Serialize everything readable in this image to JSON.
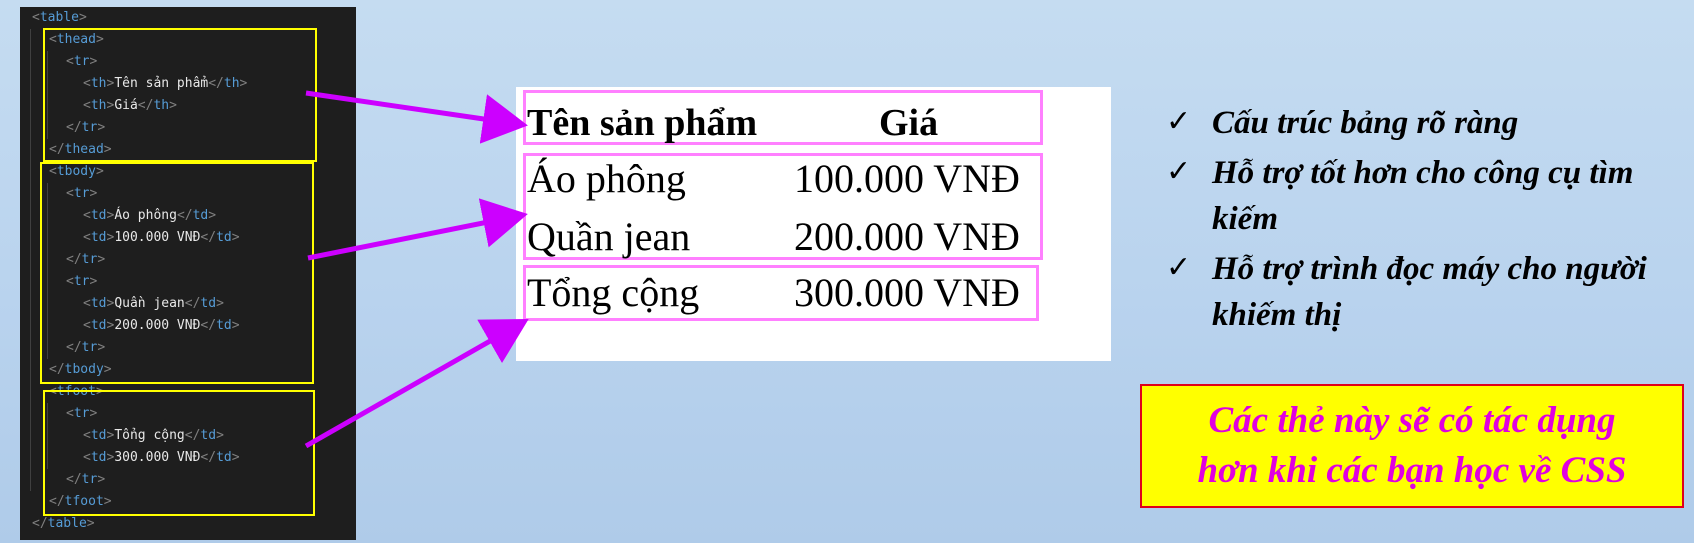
{
  "code": {
    "lines": [
      {
        "indent": 0,
        "open": "<",
        "tag": "table",
        "text": "",
        "close_tag": "",
        "end": ">"
      },
      {
        "indent": 1,
        "open": "<",
        "tag": "thead",
        "text": "",
        "close_tag": "",
        "end": ">"
      },
      {
        "indent": 2,
        "open": "<",
        "tag": "tr",
        "text": "",
        "close_tag": "",
        "end": ">"
      },
      {
        "indent": 3,
        "open": "<",
        "tag": "th",
        "text": "Tên sản phẩm",
        "close_tag": "th",
        "end": ">"
      },
      {
        "indent": 3,
        "open": "<",
        "tag": "th",
        "text": "Giá",
        "close_tag": "th",
        "end": ">"
      },
      {
        "indent": 2,
        "open": "</",
        "tag": "tr",
        "text": "",
        "close_tag": "",
        "end": ">"
      },
      {
        "indent": 1,
        "open": "</",
        "tag": "thead",
        "text": "",
        "close_tag": "",
        "end": ">"
      },
      {
        "indent": 1,
        "open": "<",
        "tag": "tbody",
        "text": "",
        "close_tag": "",
        "end": ">"
      },
      {
        "indent": 2,
        "open": "<",
        "tag": "tr",
        "text": "",
        "close_tag": "",
        "end": ">"
      },
      {
        "indent": 3,
        "open": "<",
        "tag": "td",
        "text": "Áo phông",
        "close_tag": "td",
        "end": ">"
      },
      {
        "indent": 3,
        "open": "<",
        "tag": "td",
        "text": "100.000 VNĐ",
        "close_tag": "td",
        "end": ">"
      },
      {
        "indent": 2,
        "open": "</",
        "tag": "tr",
        "text": "",
        "close_tag": "",
        "end": ">"
      },
      {
        "indent": 2,
        "open": "<",
        "tag": "tr",
        "text": "",
        "close_tag": "",
        "end": ">"
      },
      {
        "indent": 3,
        "open": "<",
        "tag": "td",
        "text": "Quần jean",
        "close_tag": "td",
        "end": ">"
      },
      {
        "indent": 3,
        "open": "<",
        "tag": "td",
        "text": "200.000 VNĐ",
        "close_tag": "td",
        "end": ">"
      },
      {
        "indent": 2,
        "open": "</",
        "tag": "tr",
        "text": "",
        "close_tag": "",
        "end": ">"
      },
      {
        "indent": 1,
        "open": "</",
        "tag": "tbody",
        "text": "",
        "close_tag": "",
        "end": ">"
      },
      {
        "indent": 1,
        "open": "<",
        "tag": "tfoot",
        "text": "",
        "close_tag": "",
        "end": ">"
      },
      {
        "indent": 2,
        "open": "<",
        "tag": "tr",
        "text": "",
        "close_tag": "",
        "end": ">"
      },
      {
        "indent": 3,
        "open": "<",
        "tag": "td",
        "text": "Tổng cộng",
        "close_tag": "td",
        "end": ">"
      },
      {
        "indent": 3,
        "open": "<",
        "tag": "td",
        "text": "300.000 VNĐ",
        "close_tag": "td",
        "end": ">"
      },
      {
        "indent": 2,
        "open": "</",
        "tag": "tr",
        "text": "",
        "close_tag": "",
        "end": ">"
      },
      {
        "indent": 1,
        "open": "</",
        "tag": "tfoot",
        "text": "",
        "close_tag": "",
        "end": ">"
      },
      {
        "indent": 0,
        "open": "</",
        "tag": "table",
        "text": "",
        "close_tag": "",
        "end": ">"
      }
    ]
  },
  "preview": {
    "header": [
      "Tên sản phẩm",
      "Giá"
    ],
    "rows": [
      [
        "Áo phông",
        "100.000 VNĐ"
      ],
      [
        "Quần jean",
        "200.000 VNĐ"
      ]
    ],
    "footer": [
      "Tổng cộng",
      "300.000 VNĐ"
    ]
  },
  "bullets": {
    "mark": "✓",
    "items": [
      "Cấu trúc bảng rõ ràng",
      "Hỗ trợ tốt hơn cho công cụ tìm kiếm",
      "Hỗ trợ trình đọc máy cho người khiếm thị"
    ]
  },
  "note": {
    "line1": "Các thẻ này sẽ có tác dụng",
    "line2": "hơn khi các bạn học về CSS"
  },
  "colors": {
    "code_background": "#1e1e1e",
    "tag": "#569cd6",
    "highlight_box": "#ffff00",
    "preview_box": "#ff80ff",
    "arrow": "#cc00ff",
    "note_background": "#ffff00",
    "note_text": "#e000e0",
    "note_border": "#e0001a"
  }
}
